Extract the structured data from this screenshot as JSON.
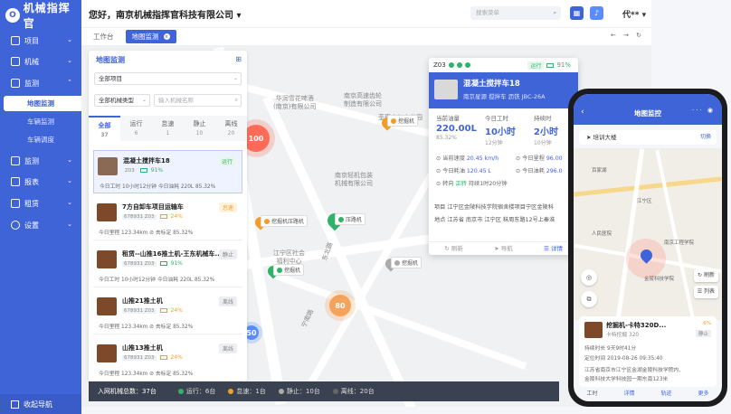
{
  "sidebar": {
    "logo_text": "机械指挥官",
    "logo_mark": "O",
    "items": [
      {
        "label": "项目"
      },
      {
        "label": "机械"
      },
      {
        "label": "监测"
      },
      {
        "label": "监测"
      },
      {
        "label": "报表"
      },
      {
        "label": "租赁"
      },
      {
        "label": "设置"
      }
    ],
    "subitems": [
      {
        "label": "地图监测"
      },
      {
        "label": "车辆监测"
      },
      {
        "label": "车辆调度"
      }
    ],
    "collapse_label": "收起导航"
  },
  "header": {
    "greeting": "您好，南京机械指挥官科技有限公司",
    "caret": "▾",
    "search_placeholder": "搜索菜单",
    "user": "代**",
    "user_caret": "▾"
  },
  "tabs": [
    {
      "label": "工作台"
    },
    {
      "label": "地图监测"
    }
  ],
  "tab_close": "×",
  "tab_controls": "← →  ↻",
  "list_panel": {
    "title": "地图监测",
    "project_select": "全部项目",
    "type_select": "全部机械类型",
    "search_placeholder": "输入机械名称",
    "status_tabs": [
      {
        "label": "全部",
        "count": "37"
      },
      {
        "label": "运行",
        "count": "6"
      },
      {
        "label": "怠速",
        "count": "1"
      },
      {
        "label": "静止",
        "count": "10"
      },
      {
        "label": "离线",
        "count": "20"
      }
    ],
    "cards": [
      {
        "name": "混凝土搅拌车18",
        "badge": "运行",
        "code": "Z03",
        "pct": "91%",
        "foot": "今日工时 10小时12分钟   今日油耗 220L   85.32%"
      },
      {
        "name": "7方自卸车项目运输车",
        "badge": "怠速",
        "code": "678931  Z03",
        "pct": "24%",
        "foot": "今日里程 123.34km   ⊘ 去标定   85.32%"
      },
      {
        "name": "租赁--山推16推土机-王东机械车...",
        "badge": "静止",
        "code": "678931  Z03",
        "pct": "91%",
        "foot": "今日工时 10小时12分钟   今日油耗 220L   85.32%"
      },
      {
        "name": "山推21推土机",
        "badge": "离线",
        "code": "678931  Z03",
        "pct": "24%",
        "foot": "今日里程 123.34km   ⊘ 去标定   85.32%"
      },
      {
        "name": "山推13推土机",
        "badge": "离线",
        "code": "678931  Z03",
        "pct": "24%",
        "foot": "今日里程 123.34km   ⊘ 去标定   85.32%"
      }
    ]
  },
  "stats_bar": {
    "total": "入网机械总数：37台",
    "running": "运行：6台",
    "idle": "怠速：1台",
    "static": "静止：10台",
    "offline": "离线：20台"
  },
  "map": {
    "labels": [
      {
        "text": "华润雪花啤酒\n(南京)有限公司"
      },
      {
        "text": "南京高速齿轮\n制造有限公司"
      },
      {
        "text": "荃惠电气产业园"
      },
      {
        "text": "南京轻机包装\n机械有限公司"
      },
      {
        "text": "江宁区社会\n福利中心"
      },
      {
        "text": "东北路"
      },
      {
        "text": "宁南路"
      }
    ],
    "clusters": [
      {
        "label": "100"
      },
      {
        "label": "80"
      },
      {
        "label": "50"
      }
    ],
    "pins": [
      {
        "label": "挖掘机"
      },
      {
        "label": "挖掘机压路机"
      },
      {
        "label": "压路机"
      },
      {
        "label": "挖掘机"
      },
      {
        "label": "挖掘机"
      }
    ]
  },
  "detail": {
    "code": "Z03",
    "status": "运行",
    "pct": "91%",
    "name": "混凝土搅拌车18",
    "tags": "南京星源   搅拌车   沥铁   JBC-26A",
    "kpis": [
      {
        "label": "当前油量",
        "value": "220.00L",
        "sub": "85.32%"
      },
      {
        "label": "今日工时",
        "value": "10小时",
        "sub": "12分钟"
      },
      {
        "label": "持续时",
        "value": "2小时",
        "sub": "10分钟"
      }
    ],
    "row1a": "当前速度",
    "row1a_v": "20.45 km/h",
    "row1b": "今日里程",
    "row1b_v": "96.00",
    "row2a": "今日耗油",
    "row2a_v": "120.45 L",
    "row2b": "今日油耗",
    "row2b_v": "296.0",
    "row3": "转向",
    "row3_v": "正转",
    "row3_tail": "持续1时20分钟",
    "project": "项目  江宁区金陵科技学院宿舍楼项目宁区金陵科",
    "address": "地点  江苏省 南京市 江宁区 秣周东路12号上秦淮",
    "foot": [
      {
        "label": "刷新"
      },
      {
        "label": "导航"
      },
      {
        "label": "详情"
      }
    ]
  },
  "phone": {
    "title": "地图监控",
    "back": "‹",
    "caps": "··· ◉",
    "location": "培训大楼",
    "switch": "切换",
    "map_labels": [
      {
        "text": "江宁区"
      },
      {
        "text": "人民医院"
      },
      {
        "text": "金陵科技学院"
      },
      {
        "text": "南京工程学院"
      },
      {
        "text": "百家湖"
      }
    ],
    "refresh": "刷新",
    "list": "列表",
    "card": {
      "name": "挖掘机-卡特320D...",
      "sub": "卡特挖掘  320",
      "pct": "6%",
      "status": "静止",
      "row1": "持续时长     9天9时41分",
      "row2": "定位时间     2019-08-26 09:35:40",
      "row3": "江苏省南京市江宁区金湖金陵科技学院内,",
      "row4": "金陵科技大学科技园一期东南123米"
    },
    "nav": [
      {
        "label": "工时"
      },
      {
        "label": "详情"
      },
      {
        "label": "轨迹"
      },
      {
        "label": "更多"
      }
    ]
  },
  "colors": {
    "primary": "#3f64d8",
    "running": "#2fb36a",
    "idle": "#f29d27",
    "offline": "#888888",
    "cluster_red": "#ff6b57",
    "cluster_orange": "#f5a25a"
  }
}
